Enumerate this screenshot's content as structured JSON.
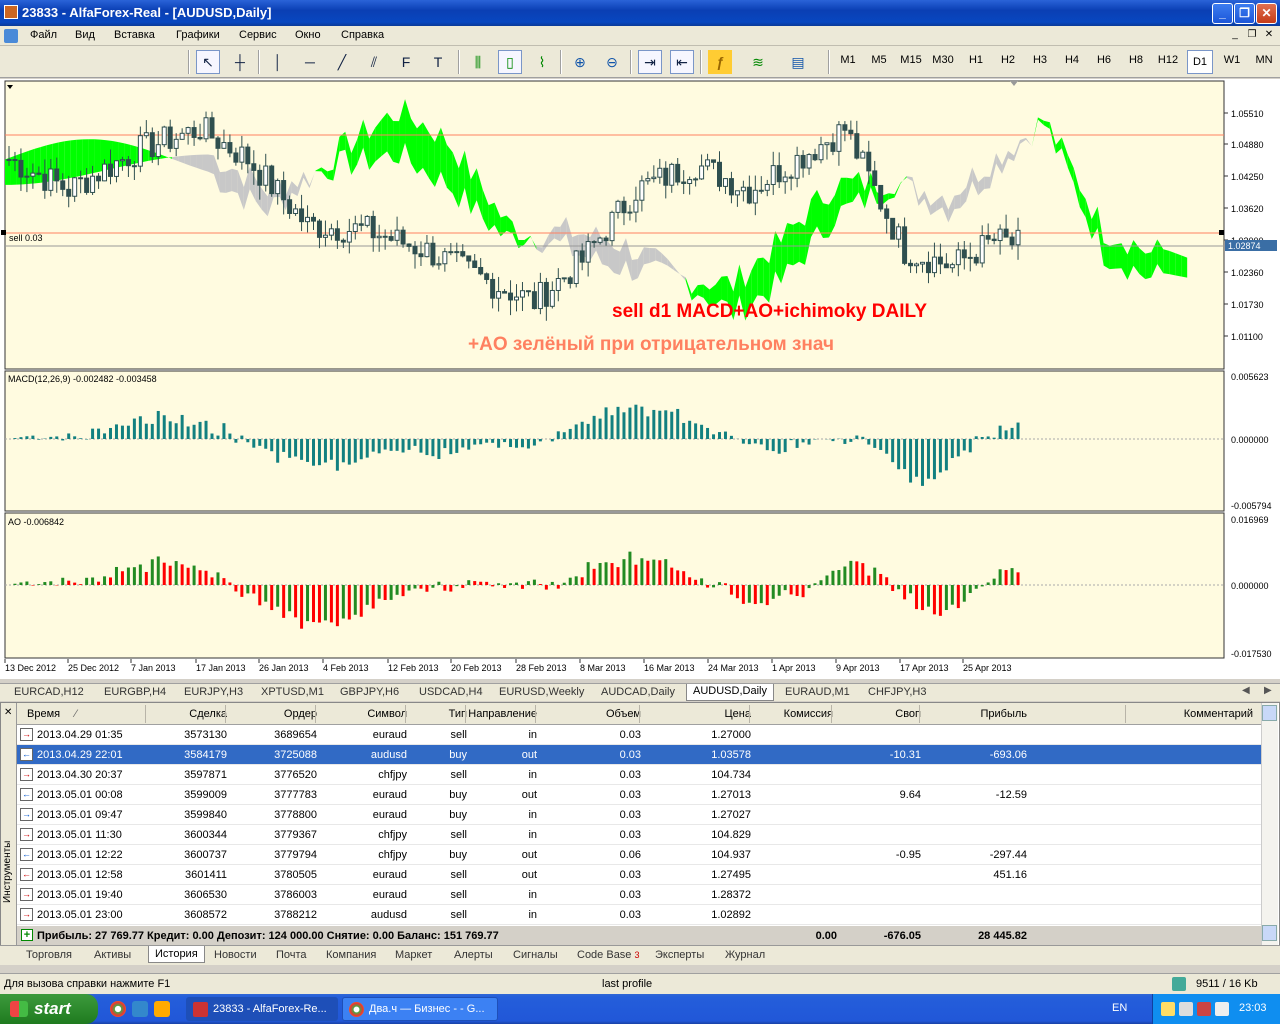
{
  "window": {
    "title": "23833 - AlfaForex-Real - [AUDUSD,Daily]",
    "buttons": [
      "_",
      "❐",
      "✕"
    ]
  },
  "menu": [
    "Файл",
    "Вид",
    "Вставка",
    "Графики",
    "Сервис",
    "Окно",
    "Справка"
  ],
  "mdi_buttons": [
    "_",
    "❐",
    "✕"
  ],
  "toolbar": {
    "tools": [
      {
        "name": "cursor-icon",
        "glyph": "↖"
      },
      {
        "name": "crosshair-icon",
        "glyph": "┼"
      },
      {
        "name": "vertical-line-icon",
        "glyph": "│"
      },
      {
        "name": "horizontal-line-icon",
        "glyph": "─"
      },
      {
        "name": "trendline-icon",
        "glyph": "╱"
      },
      {
        "name": "channel-icon",
        "glyph": "⫽"
      },
      {
        "name": "fibonacci-icon",
        "glyph": "F"
      },
      {
        "name": "text-icon",
        "glyph": "T"
      },
      {
        "name": "bar-chart-icon",
        "glyph": "⫼"
      },
      {
        "name": "candle-chart-icon",
        "glyph": "▯"
      },
      {
        "name": "line-chart-icon",
        "glyph": "⌇"
      },
      {
        "name": "zoom-in-icon",
        "glyph": "⊕"
      },
      {
        "name": "zoom-out-icon",
        "glyph": "⊖"
      },
      {
        "name": "autoscroll-icon",
        "glyph": "⇥"
      },
      {
        "name": "chart-shift-icon",
        "glyph": "⇤"
      },
      {
        "name": "indicators-icon",
        "glyph": "ƒ"
      },
      {
        "name": "periods-icon",
        "glyph": "≋"
      },
      {
        "name": "templates-icon",
        "glyph": "▤"
      }
    ],
    "timeframes": [
      "M1",
      "M5",
      "M15",
      "M30",
      "H1",
      "H2",
      "H3",
      "H4",
      "H6",
      "H8",
      "H12",
      "D1",
      "W1",
      "MN"
    ],
    "active_timeframe": "D1"
  },
  "chart": {
    "symbol": "AUDUSD",
    "period": "Daily",
    "price_axis": [
      "1.05510",
      "1.04880",
      "1.04250",
      "1.03620",
      "1.03000",
      "1.02360",
      "1.01730",
      "1.01100"
    ],
    "current_price": "1.02874",
    "level_label": "sell 0.03",
    "annotation1": "sell d1  MACD+AO+ichimoky DAILY",
    "annotation2": "+AO зелёный при отрицательном знач",
    "macd_label": "MACD(12,26,9) -0.002482 -0.003458",
    "macd_axis": [
      "0.005623",
      "0.000000",
      "-0.005794"
    ],
    "ao_label": "AO -0.006842",
    "ao_axis": [
      "0.016969",
      "0.000000",
      "-0.017530"
    ],
    "time_axis": [
      "13 Dec 2012",
      "25 Dec 2012",
      "7 Jan 2013",
      "17 Jan 2013",
      "26 Jan 2013",
      "4 Feb 2013",
      "12 Feb 2013",
      "20 Feb 2013",
      "28 Feb 2013",
      "8 Mar 2013",
      "16 Mar 2013",
      "24 Mar 2013",
      "1 Apr 2013",
      "9 Apr 2013",
      "17 Apr 2013",
      "25 Apr 2013"
    ],
    "colors": {
      "bg": "#fffbe0",
      "cloud_bull": "#00ff00",
      "cloud_bear": "#c8c8c8",
      "macd": "#128080",
      "ao_up": "#228b22",
      "ao_down": "#ff0000",
      "level": "#ff8060",
      "annot1": "#ff0000",
      "annot2": "#ff8060"
    }
  },
  "chart_tabs": [
    "EURCAD,H12",
    "EURGBP,H4",
    "EURJPY,H3",
    "XPTUSD,M1",
    "GBPJPY,H6",
    "USDCAD,H4",
    "EURUSD,Weekly",
    "AUDCAD,Daily",
    "AUDUSD,Daily",
    "EURAUD,M1",
    "CHFJPY,H3"
  ],
  "active_chart_tab": "AUDUSD,Daily",
  "terminal": {
    "side_label": "Инструменты",
    "headers": [
      "Время",
      "Сделка",
      "Ордер",
      "Символ",
      "Тип",
      "Направление",
      "Объем",
      "Цена",
      "Комиссия",
      "Своп",
      "Прибыль",
      "Комментарий"
    ],
    "rows": [
      {
        "time": "2013.04.29 01:35",
        "deal": "3573130",
        "order": "3689654",
        "symbol": "euraud",
        "type": "sell",
        "dir": "in",
        "vol": "0.03",
        "price": "1.27000",
        "comm": "",
        "swap": "",
        "profit": ""
      },
      {
        "time": "2013.04.29 22:01",
        "deal": "3584179",
        "order": "3725088",
        "symbol": "audusd",
        "type": "buy",
        "dir": "out",
        "vol": "0.03",
        "price": "1.03578",
        "comm": "",
        "swap": "-10.31",
        "profit": "-693.06"
      },
      {
        "time": "2013.04.30 20:37",
        "deal": "3597871",
        "order": "3776520",
        "symbol": "chfjpy",
        "type": "sell",
        "dir": "in",
        "vol": "0.03",
        "price": "104.734",
        "comm": "",
        "swap": "",
        "profit": ""
      },
      {
        "time": "2013.05.01 00:08",
        "deal": "3599009",
        "order": "3777783",
        "symbol": "euraud",
        "type": "buy",
        "dir": "out",
        "vol": "0.03",
        "price": "1.27013",
        "comm": "",
        "swap": "9.64",
        "profit": "-12.59"
      },
      {
        "time": "2013.05.01 09:47",
        "deal": "3599840",
        "order": "3778800",
        "symbol": "euraud",
        "type": "buy",
        "dir": "in",
        "vol": "0.03",
        "price": "1.27027",
        "comm": "",
        "swap": "",
        "profit": ""
      },
      {
        "time": "2013.05.01 11:30",
        "deal": "3600344",
        "order": "3779367",
        "symbol": "chfjpy",
        "type": "sell",
        "dir": "in",
        "vol": "0.03",
        "price": "104.829",
        "comm": "",
        "swap": "",
        "profit": ""
      },
      {
        "time": "2013.05.01 12:22",
        "deal": "3600737",
        "order": "3779794",
        "symbol": "chfjpy",
        "type": "buy",
        "dir": "out",
        "vol": "0.06",
        "price": "104.937",
        "comm": "",
        "swap": "-0.95",
        "profit": "-297.44"
      },
      {
        "time": "2013.05.01 12:58",
        "deal": "3601411",
        "order": "3780505",
        "symbol": "euraud",
        "type": "sell",
        "dir": "out",
        "vol": "0.03",
        "price": "1.27495",
        "comm": "",
        "swap": "",
        "profit": "451.16"
      },
      {
        "time": "2013.05.01 19:40",
        "deal": "3606530",
        "order": "3786003",
        "symbol": "euraud",
        "type": "sell",
        "dir": "in",
        "vol": "0.03",
        "price": "1.28372",
        "comm": "",
        "swap": "",
        "profit": ""
      },
      {
        "time": "2013.05.01 23:00",
        "deal": "3608572",
        "order": "3788212",
        "symbol": "audusd",
        "type": "sell",
        "dir": "in",
        "vol": "0.03",
        "price": "1.02892",
        "comm": "",
        "swap": "",
        "profit": ""
      }
    ],
    "selected_row": 1,
    "summary": {
      "text": "Прибыль: 27 769.77  Кредит: 0.00  Депозит: 124 000.00  Снятие: 0.00  Баланс: 151 769.77",
      "comm": "0.00",
      "swap": "-676.05",
      "profit": "28 445.82"
    }
  },
  "bottom_tabs": [
    "Торговля",
    "Активы",
    "История",
    "Новости",
    "Почта",
    "Компания",
    "Маркет",
    "Алерты",
    "Сигналы",
    "Code Base",
    "Эксперты",
    "Журнал"
  ],
  "active_bottom_tab": "История",
  "codebase_badge": "3",
  "status": {
    "help": "Для вызова справки нажмите F1",
    "profile": "last profile",
    "traffic": "9511 / 16 Kb"
  },
  "taskbar": {
    "start": "start",
    "tasks": [
      "23833 - AlfaForex-Re...",
      "Два.ч — Бизнес - - G..."
    ],
    "lang": "EN",
    "time": "23:03"
  }
}
